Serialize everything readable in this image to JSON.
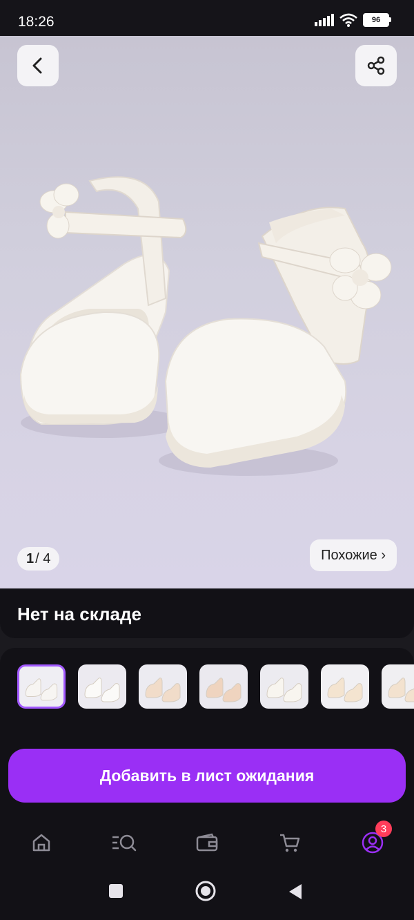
{
  "status": {
    "time": "18:26",
    "battery": "96"
  },
  "hero": {
    "page_current": "1",
    "page_total": "/ 4",
    "similar_label": "Похожие ›",
    "back_icon": "chevron-left-icon",
    "share_icon": "share-icon"
  },
  "product": {
    "availability": "Нет на складе"
  },
  "thumbnails": [
    {
      "tone": "#efeef3",
      "shoe": "#f7f5f2"
    },
    {
      "tone": "#eceaf0",
      "shoe": "#fbfaf8"
    },
    {
      "tone": "#ecebf1",
      "shoe": "#f1dcc9"
    },
    {
      "tone": "#ebe9ef",
      "shoe": "#efd4bf"
    },
    {
      "tone": "#ecebf0",
      "shoe": "#f8f5ef"
    },
    {
      "tone": "#f1f0f3",
      "shoe": "#f4e4d0"
    },
    {
      "tone": "#f0eff2",
      "shoe": "#f3e2cf"
    }
  ],
  "actions": {
    "waitlist_label": "Добавить в лист ожидания"
  },
  "bottom_nav": {
    "items": [
      "home-icon",
      "catalog-search-icon",
      "wallet-icon",
      "cart-icon",
      "profile-icon"
    ],
    "profile_badge": "3"
  },
  "colors": {
    "accent": "#9a2ff5",
    "badge": "#ff3d5a"
  }
}
